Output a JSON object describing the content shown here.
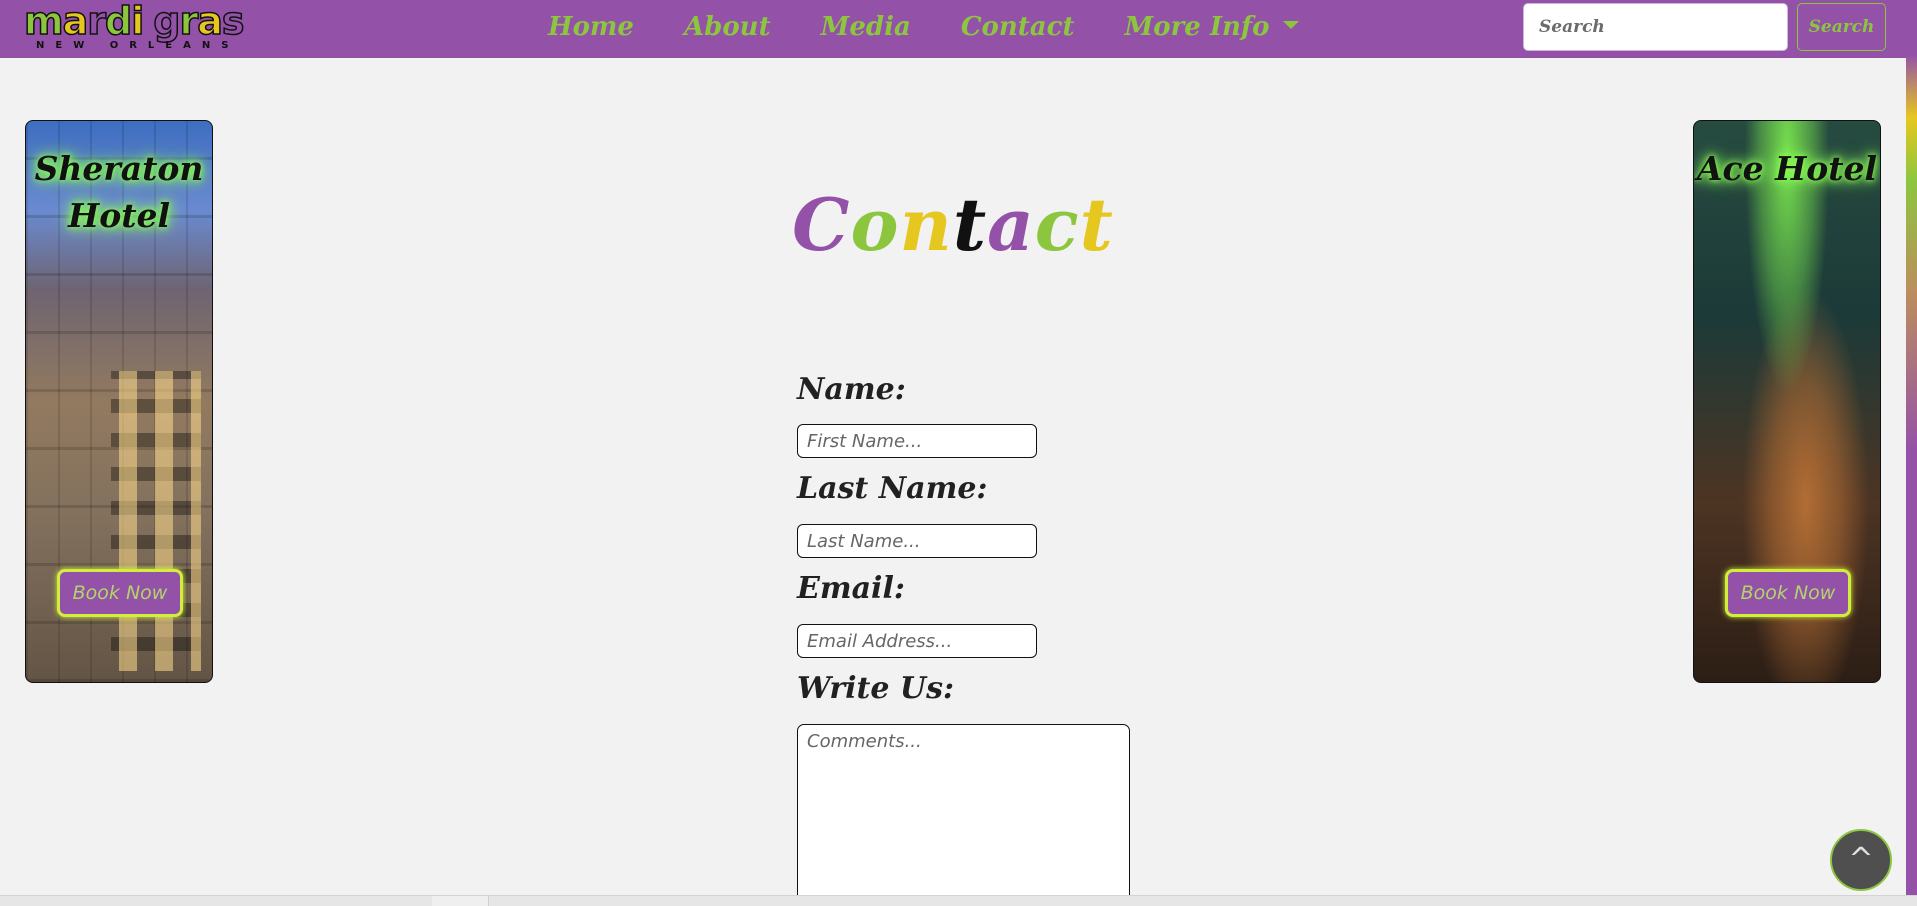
{
  "logo": {
    "word_letters": [
      "m",
      "a",
      "r",
      "d",
      "i",
      " ",
      "g",
      "r",
      "a",
      "s"
    ],
    "word_colors": [
      "#8cc63f",
      "#e6c720",
      "#9351a8",
      "#8cc63f",
      "#e6c720",
      "",
      "#9351a8",
      "#8cc63f",
      "#e6c720",
      "#9351a8"
    ],
    "subtitle": "NEW ORLEANS"
  },
  "nav": {
    "items": [
      {
        "label": "Home"
      },
      {
        "label": "About"
      },
      {
        "label": "Media"
      },
      {
        "label": "Contact"
      }
    ],
    "more_label": "More Info",
    "more_icon": "caret-down-icon"
  },
  "search": {
    "placeholder": "Search",
    "button_label": "Search"
  },
  "hotels": {
    "left": {
      "name_line1": "Sheraton",
      "name_line2": "Hotel",
      "button_label": "Book Now"
    },
    "right": {
      "name_line1": "Ace Hotel",
      "button_label": "Book Now"
    }
  },
  "page_title": {
    "letters": [
      "C",
      "o",
      "n",
      "t",
      "a",
      "c",
      "t"
    ],
    "colors": [
      "#9351a8",
      "#8cc63f",
      "#e6c720",
      "#111111",
      "#9351a8",
      "#8cc63f",
      "#e6c720"
    ]
  },
  "form": {
    "name_label": "Name:",
    "name_placeholder": "First Name...",
    "last_name_label": "Last Name:",
    "last_name_placeholder": "Last Name...",
    "email_label": "Email:",
    "email_placeholder": "Email Address...",
    "comments_label": "Write Us:",
    "comments_placeholder": "Comments..."
  },
  "back_to_top": {
    "label": "^"
  },
  "colors": {
    "nav_bg": "#9351a8",
    "accent_green": "#8cc63f",
    "accent_gold": "#e6c720",
    "page_bg": "#f2f2f2"
  }
}
